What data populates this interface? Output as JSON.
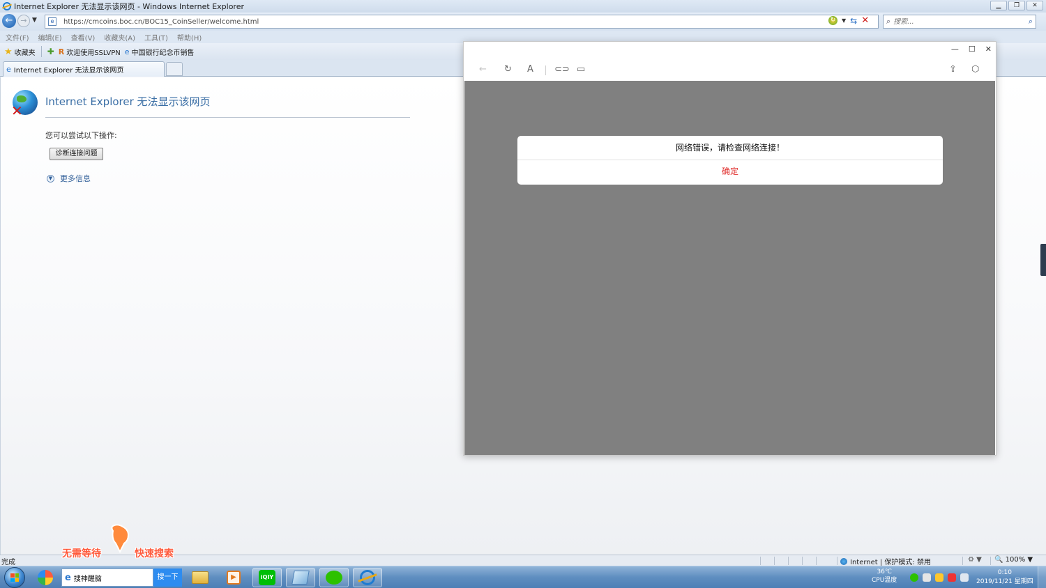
{
  "ie": {
    "window_title": "Internet Explorer 无法显示该网页 - Windows Internet Explorer",
    "url": "https://cmcoins.boc.cn/BOC15_CoinSeller/welcome.html",
    "search_placeholder": "搜索...",
    "menu": [
      "文件(F)",
      "编辑(E)",
      "查看(V)",
      "收藏夹(A)",
      "工具(T)",
      "帮助(H)"
    ],
    "favorites_label": "收藏夹",
    "favorites": [
      {
        "label": "欢迎使用SSLVPN",
        "icon": "r-icon"
      },
      {
        "label": "中国银行纪念币销售",
        "icon": "ie-page-icon"
      }
    ],
    "tab_label": "Internet Explorer 无法显示该网页"
  },
  "error_page": {
    "title": "Internet Explorer 无法显示该网页",
    "try_text": "您可以尝试以下操作:",
    "diagnose_button": "诊断连接问题",
    "more_info": "更多信息"
  },
  "popup": {
    "dialog_message": "网络错误，请检查网络连接！",
    "ok_label": "确定"
  },
  "status_bar": {
    "status": "完成",
    "zone": "Internet | 保护模式: 禁用",
    "zoom": "100%"
  },
  "ad": {
    "left": "无需等待",
    "right": "快速搜索"
  },
  "taskbar": {
    "search_text": "搜神醒脑",
    "search_button": "搜一下",
    "cpu_temp": "36℃",
    "cpu_label": "CPU温度",
    "time": "0:10",
    "date": "2019/11/21 星期四"
  }
}
